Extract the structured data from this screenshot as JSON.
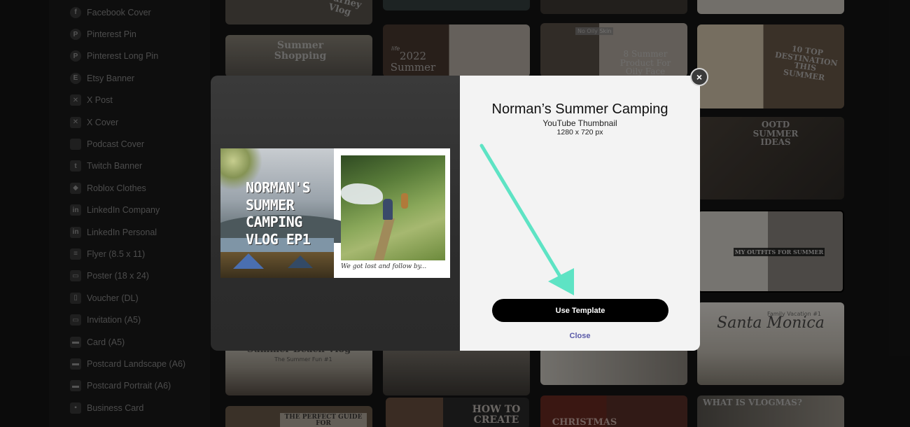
{
  "sidebar": {
    "items": [
      {
        "label": "Facebook Cover",
        "icon": "facebook-icon"
      },
      {
        "label": "Pinterest Pin",
        "icon": "pinterest-icon"
      },
      {
        "label": "Pinterest Long Pin",
        "icon": "pinterest-icon"
      },
      {
        "label": "Etsy Banner",
        "icon": "etsy-icon"
      },
      {
        "label": "X Post",
        "icon": "x-icon"
      },
      {
        "label": "X Cover",
        "icon": "x-icon"
      },
      {
        "label": "Podcast Cover",
        "icon": "podcast-icon"
      },
      {
        "label": "Twitch Banner",
        "icon": "twitch-icon"
      },
      {
        "label": "Roblox Clothes",
        "icon": "roblox-icon"
      },
      {
        "label": "LinkedIn Company",
        "icon": "linkedin-icon"
      },
      {
        "label": "LinkedIn Personal",
        "icon": "linkedin-icon"
      },
      {
        "label": "Flyer (8.5 x 11)",
        "icon": "flyer-icon"
      },
      {
        "label": "Poster (18 x 24)",
        "icon": "poster-icon"
      },
      {
        "label": "Voucher (DL)",
        "icon": "voucher-icon"
      },
      {
        "label": "Invitation (A5)",
        "icon": "invitation-icon"
      },
      {
        "label": "Card (A5)",
        "icon": "card-icon"
      },
      {
        "label": "Postcard Landscape (A6)",
        "icon": "postcard-icon"
      },
      {
        "label": "Postcard Portrait (A6)",
        "icon": "postcard-icon"
      },
      {
        "label": "Business Card",
        "icon": "business-card-icon"
      }
    ]
  },
  "grid": {
    "tiles": [
      {
        "title": "Journey Vlog"
      },
      {
        "title": "Summer Shopping"
      },
      {
        "title": "2022 Summer",
        "sub": "life"
      },
      {
        "title": "8 Summer Product For Oily Face",
        "sub": "No Oily Skin"
      },
      {
        "title": "10 TOP DESTINATION THIS SUMMER"
      },
      {
        "title": "OOTD SUMMER IDEAS"
      },
      {
        "title": "MY OUTFITS FOR SUMMER"
      },
      {
        "title": "Santa Monica",
        "sub": "Family Vacation #1"
      },
      {
        "title": "Summer Beach Vlog",
        "sub": "The Summer Fun #1"
      },
      {
        "title": "THE PERFECT GUIDE FOR"
      },
      {
        "title": "HOW TO CREATE"
      },
      {
        "title": "CHRISTMAS"
      },
      {
        "title": "WHAT IS VLOGMAS?"
      }
    ]
  },
  "modal": {
    "title": "Norman’s Summer Camping",
    "subtitle": "YouTube Thumbnail",
    "size": "1280 x 720 px",
    "use_button": "Use Template",
    "close_link": "Close",
    "close_symbol": "×",
    "preview": {
      "title_lines": [
        "NORMAN'S",
        "SUMMER",
        "CAMPING",
        "VLOG EP1"
      ],
      "caption": "We got lost and follow by..."
    }
  },
  "colors": {
    "arrow": "#5ee3c4",
    "button_bg": "#000000",
    "close_link": "#5a5aa8"
  }
}
